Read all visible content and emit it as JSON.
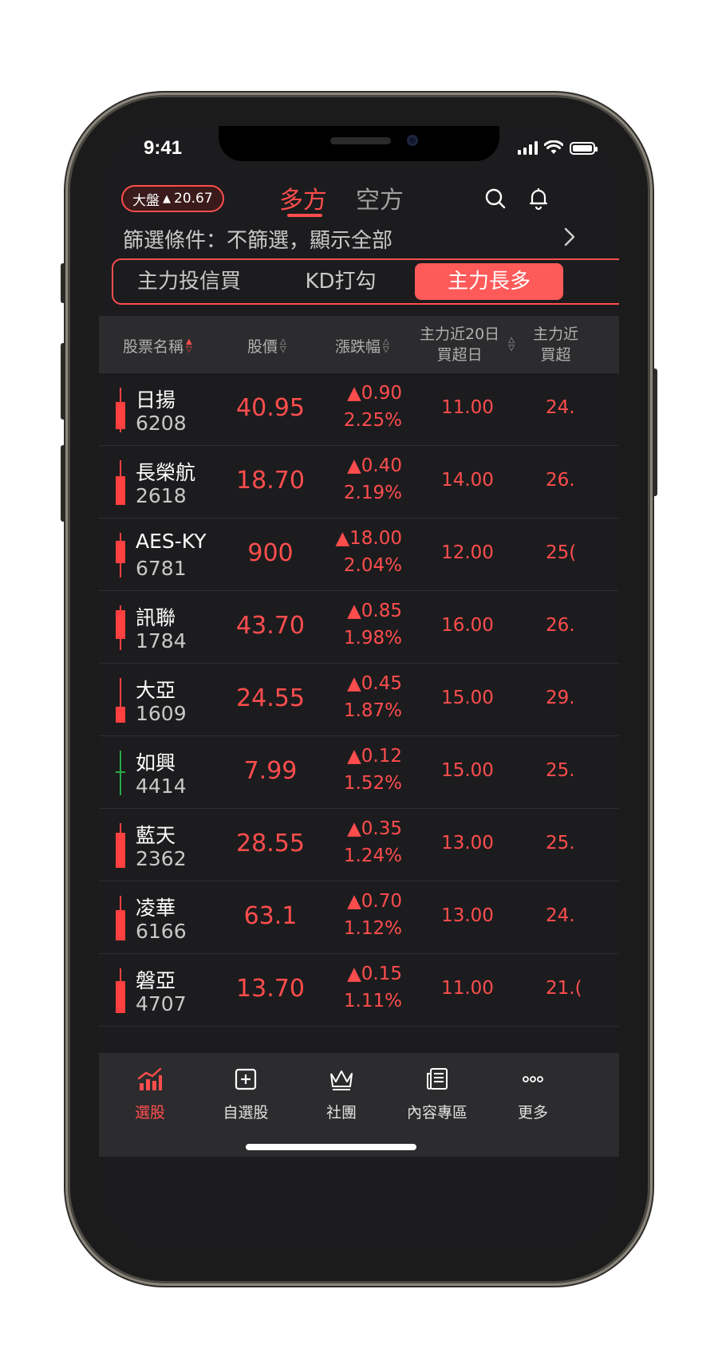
{
  "status_bar": {
    "time": "9:41"
  },
  "header": {
    "market_label": "大盤",
    "market_change": "20.67",
    "tab_long": "多方",
    "tab_short": "空方"
  },
  "filter": {
    "text": "篩選條件：不篩選，顯示全部"
  },
  "segments": [
    "主力投信買",
    "KD打勾",
    "主力長多"
  ],
  "columns": {
    "name": "股票名稱",
    "price": "股價",
    "change": "漲跌幅",
    "d20_line1": "主力近20日",
    "d20_line2": "買超日",
    "dx_line1": "主力近",
    "dx_line2": "買超"
  },
  "colors": {
    "accent": "#ff4d4d",
    "up_candle": "#ff4040",
    "down_candle": "#2aa84a"
  },
  "rows": [
    {
      "name": "日揚",
      "code": "6208",
      "price": "40.95",
      "change": "▲0.90",
      "pct": "2.25%",
      "d20": "11.00",
      "dx": "24.",
      "candle": "red"
    },
    {
      "name": "長榮航",
      "code": "2618",
      "price": "18.70",
      "change": "▲0.40",
      "pct": "2.19%",
      "d20": "14.00",
      "dx": "26.",
      "candle": "red"
    },
    {
      "name": "AES-KY",
      "code": "6781",
      "price": "900",
      "change": "▲18.00",
      "pct": "2.04%",
      "d20": "12.00",
      "dx": "25(",
      "candle": "red"
    },
    {
      "name": "訊聯",
      "code": "1784",
      "price": "43.70",
      "change": "▲0.85",
      "pct": "1.98%",
      "d20": "16.00",
      "dx": "26.",
      "candle": "red"
    },
    {
      "name": "大亞",
      "code": "1609",
      "price": "24.55",
      "change": "▲0.45",
      "pct": "1.87%",
      "d20": "15.00",
      "dx": "29.",
      "candle": "red"
    },
    {
      "name": "如興",
      "code": "4414",
      "price": "7.99",
      "change": "▲0.12",
      "pct": "1.52%",
      "d20": "15.00",
      "dx": "25.",
      "candle": "green"
    },
    {
      "name": "藍天",
      "code": "2362",
      "price": "28.55",
      "change": "▲0.35",
      "pct": "1.24%",
      "d20": "13.00",
      "dx": "25.",
      "candle": "red"
    },
    {
      "name": "凌華",
      "code": "6166",
      "price": "63.1",
      "change": "▲0.70",
      "pct": "1.12%",
      "d20": "13.00",
      "dx": "24.",
      "candle": "red"
    },
    {
      "name": "磐亞",
      "code": "4707",
      "price": "13.70",
      "change": "▲0.15",
      "pct": "1.11%",
      "d20": "11.00",
      "dx": "21.(",
      "candle": "red"
    }
  ],
  "tabbar": [
    {
      "label": "選股",
      "icon": "chart-icon",
      "active": true
    },
    {
      "label": "自選股",
      "icon": "plus-box-icon",
      "active": false
    },
    {
      "label": "社團",
      "icon": "crown-icon",
      "active": false
    },
    {
      "label": "內容專區",
      "icon": "news-icon",
      "active": false
    },
    {
      "label": "更多",
      "icon": "more-icon",
      "active": false
    }
  ]
}
